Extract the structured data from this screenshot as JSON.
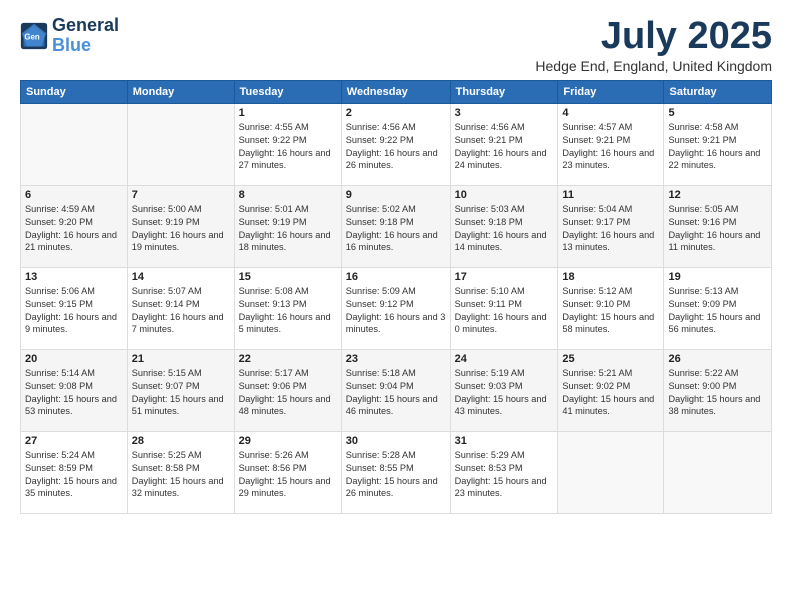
{
  "header": {
    "logo_line1": "General",
    "logo_line2": "Blue",
    "title": "July 2025",
    "location": "Hedge End, England, United Kingdom"
  },
  "weekdays": [
    "Sunday",
    "Monday",
    "Tuesday",
    "Wednesday",
    "Thursday",
    "Friday",
    "Saturday"
  ],
  "weeks": [
    [
      {
        "day": "",
        "sunrise": "",
        "sunset": "",
        "daylight": ""
      },
      {
        "day": "",
        "sunrise": "",
        "sunset": "",
        "daylight": ""
      },
      {
        "day": "1",
        "sunrise": "Sunrise: 4:55 AM",
        "sunset": "Sunset: 9:22 PM",
        "daylight": "Daylight: 16 hours and 27 minutes."
      },
      {
        "day": "2",
        "sunrise": "Sunrise: 4:56 AM",
        "sunset": "Sunset: 9:22 PM",
        "daylight": "Daylight: 16 hours and 26 minutes."
      },
      {
        "day": "3",
        "sunrise": "Sunrise: 4:56 AM",
        "sunset": "Sunset: 9:21 PM",
        "daylight": "Daylight: 16 hours and 24 minutes."
      },
      {
        "day": "4",
        "sunrise": "Sunrise: 4:57 AM",
        "sunset": "Sunset: 9:21 PM",
        "daylight": "Daylight: 16 hours and 23 minutes."
      },
      {
        "day": "5",
        "sunrise": "Sunrise: 4:58 AM",
        "sunset": "Sunset: 9:21 PM",
        "daylight": "Daylight: 16 hours and 22 minutes."
      }
    ],
    [
      {
        "day": "6",
        "sunrise": "Sunrise: 4:59 AM",
        "sunset": "Sunset: 9:20 PM",
        "daylight": "Daylight: 16 hours and 21 minutes."
      },
      {
        "day": "7",
        "sunrise": "Sunrise: 5:00 AM",
        "sunset": "Sunset: 9:19 PM",
        "daylight": "Daylight: 16 hours and 19 minutes."
      },
      {
        "day": "8",
        "sunrise": "Sunrise: 5:01 AM",
        "sunset": "Sunset: 9:19 PM",
        "daylight": "Daylight: 16 hours and 18 minutes."
      },
      {
        "day": "9",
        "sunrise": "Sunrise: 5:02 AM",
        "sunset": "Sunset: 9:18 PM",
        "daylight": "Daylight: 16 hours and 16 minutes."
      },
      {
        "day": "10",
        "sunrise": "Sunrise: 5:03 AM",
        "sunset": "Sunset: 9:18 PM",
        "daylight": "Daylight: 16 hours and 14 minutes."
      },
      {
        "day": "11",
        "sunrise": "Sunrise: 5:04 AM",
        "sunset": "Sunset: 9:17 PM",
        "daylight": "Daylight: 16 hours and 13 minutes."
      },
      {
        "day": "12",
        "sunrise": "Sunrise: 5:05 AM",
        "sunset": "Sunset: 9:16 PM",
        "daylight": "Daylight: 16 hours and 11 minutes."
      }
    ],
    [
      {
        "day": "13",
        "sunrise": "Sunrise: 5:06 AM",
        "sunset": "Sunset: 9:15 PM",
        "daylight": "Daylight: 16 hours and 9 minutes."
      },
      {
        "day": "14",
        "sunrise": "Sunrise: 5:07 AM",
        "sunset": "Sunset: 9:14 PM",
        "daylight": "Daylight: 16 hours and 7 minutes."
      },
      {
        "day": "15",
        "sunrise": "Sunrise: 5:08 AM",
        "sunset": "Sunset: 9:13 PM",
        "daylight": "Daylight: 16 hours and 5 minutes."
      },
      {
        "day": "16",
        "sunrise": "Sunrise: 5:09 AM",
        "sunset": "Sunset: 9:12 PM",
        "daylight": "Daylight: 16 hours and 3 minutes."
      },
      {
        "day": "17",
        "sunrise": "Sunrise: 5:10 AM",
        "sunset": "Sunset: 9:11 PM",
        "daylight": "Daylight: 16 hours and 0 minutes."
      },
      {
        "day": "18",
        "sunrise": "Sunrise: 5:12 AM",
        "sunset": "Sunset: 9:10 PM",
        "daylight": "Daylight: 15 hours and 58 minutes."
      },
      {
        "day": "19",
        "sunrise": "Sunrise: 5:13 AM",
        "sunset": "Sunset: 9:09 PM",
        "daylight": "Daylight: 15 hours and 56 minutes."
      }
    ],
    [
      {
        "day": "20",
        "sunrise": "Sunrise: 5:14 AM",
        "sunset": "Sunset: 9:08 PM",
        "daylight": "Daylight: 15 hours and 53 minutes."
      },
      {
        "day": "21",
        "sunrise": "Sunrise: 5:15 AM",
        "sunset": "Sunset: 9:07 PM",
        "daylight": "Daylight: 15 hours and 51 minutes."
      },
      {
        "day": "22",
        "sunrise": "Sunrise: 5:17 AM",
        "sunset": "Sunset: 9:06 PM",
        "daylight": "Daylight: 15 hours and 48 minutes."
      },
      {
        "day": "23",
        "sunrise": "Sunrise: 5:18 AM",
        "sunset": "Sunset: 9:04 PM",
        "daylight": "Daylight: 15 hours and 46 minutes."
      },
      {
        "day": "24",
        "sunrise": "Sunrise: 5:19 AM",
        "sunset": "Sunset: 9:03 PM",
        "daylight": "Daylight: 15 hours and 43 minutes."
      },
      {
        "day": "25",
        "sunrise": "Sunrise: 5:21 AM",
        "sunset": "Sunset: 9:02 PM",
        "daylight": "Daylight: 15 hours and 41 minutes."
      },
      {
        "day": "26",
        "sunrise": "Sunrise: 5:22 AM",
        "sunset": "Sunset: 9:00 PM",
        "daylight": "Daylight: 15 hours and 38 minutes."
      }
    ],
    [
      {
        "day": "27",
        "sunrise": "Sunrise: 5:24 AM",
        "sunset": "Sunset: 8:59 PM",
        "daylight": "Daylight: 15 hours and 35 minutes."
      },
      {
        "day": "28",
        "sunrise": "Sunrise: 5:25 AM",
        "sunset": "Sunset: 8:58 PM",
        "daylight": "Daylight: 15 hours and 32 minutes."
      },
      {
        "day": "29",
        "sunrise": "Sunrise: 5:26 AM",
        "sunset": "Sunset: 8:56 PM",
        "daylight": "Daylight: 15 hours and 29 minutes."
      },
      {
        "day": "30",
        "sunrise": "Sunrise: 5:28 AM",
        "sunset": "Sunset: 8:55 PM",
        "daylight": "Daylight: 15 hours and 26 minutes."
      },
      {
        "day": "31",
        "sunrise": "Sunrise: 5:29 AM",
        "sunset": "Sunset: 8:53 PM",
        "daylight": "Daylight: 15 hours and 23 minutes."
      },
      {
        "day": "",
        "sunrise": "",
        "sunset": "",
        "daylight": ""
      },
      {
        "day": "",
        "sunrise": "",
        "sunset": "",
        "daylight": ""
      }
    ]
  ]
}
